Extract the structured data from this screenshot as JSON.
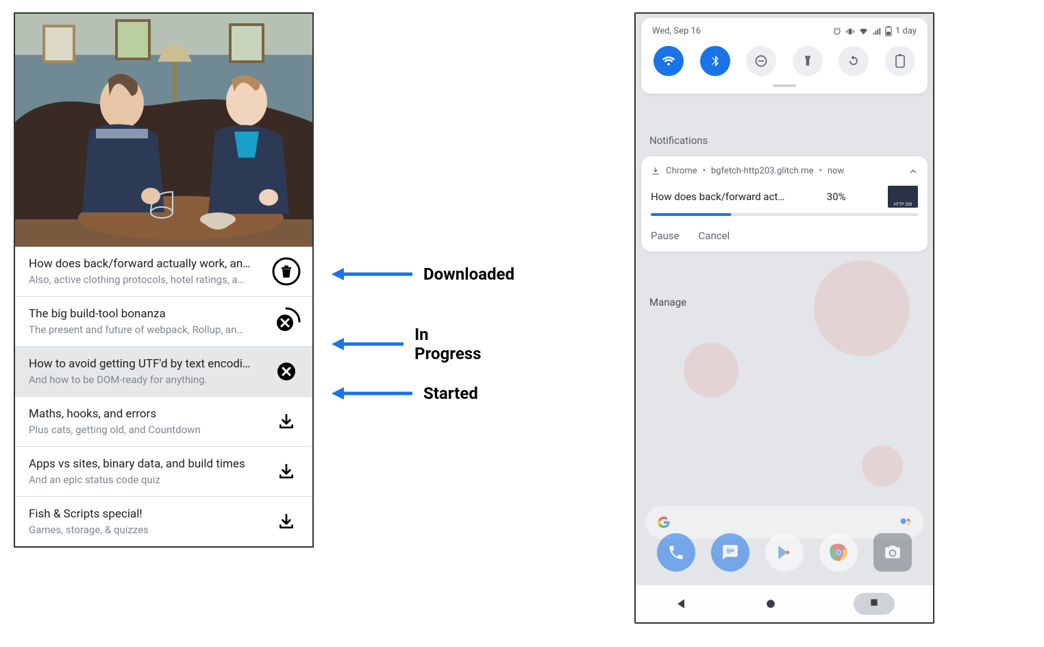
{
  "episodes": [
    {
      "title": "How does back/forward actually work, an…",
      "subtitle": "Also, active clothing protocols, hotel ratings, a…",
      "state": "downloaded"
    },
    {
      "title": "The big build-tool bonanza",
      "subtitle": "The present and future of webpack, Rollup, an…",
      "state": "progress"
    },
    {
      "title": "How to avoid getting UTF'd by text encodi…",
      "subtitle": "And how to be DOM-ready for anything.",
      "state": "started"
    },
    {
      "title": "Maths, hooks, and errors",
      "subtitle": "Plus cats, getting old, and Countdown",
      "state": "download"
    },
    {
      "title": "Apps vs sites, binary data, and build times",
      "subtitle": "And an epic status code quiz",
      "state": "download"
    },
    {
      "title": "Fish & Scripts special!",
      "subtitle": "Games, storage, & quizzes",
      "state": "download"
    }
  ],
  "annotations": {
    "downloaded": "Downloaded",
    "in_progress": "In Progress",
    "started": "Started"
  },
  "phone": {
    "date": "Wed, Sep 16",
    "battery_label": "1 day",
    "notifications_header": "Notifications",
    "notification": {
      "app": "Chrome",
      "source": "bgfetch-http203.glitch.me",
      "time": "now",
      "title": "How does back/forward act…",
      "percent_label": "30%",
      "percent_value": 30,
      "thumb_caption": "HTTP 203",
      "actions": {
        "pause": "Pause",
        "cancel": "Cancel"
      }
    },
    "manage": "Manage"
  }
}
